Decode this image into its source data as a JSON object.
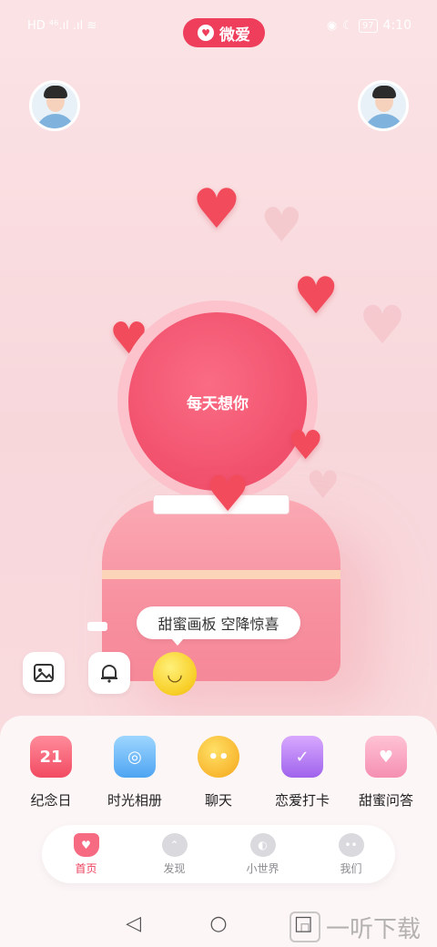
{
  "status_bar": {
    "left_glyphs": "HD ⁴⁶.ıl .ıl ≋",
    "battery": "97",
    "time": "4:10"
  },
  "app": {
    "title": "微爱",
    "brand_color": "#ee3e5c"
  },
  "avatars": {
    "left": "avatar-male",
    "right": "avatar-male"
  },
  "main": {
    "circle_text": "每天想你",
    "tooltip": "甜蜜画板 空降惊喜"
  },
  "tools": {
    "gallery_icon": "image-icon",
    "bell_icon": "bell-icon",
    "emoji_icon": "smiley-icon"
  },
  "features": [
    {
      "label": "纪念日",
      "icon": "calendar-icon",
      "badge": "21"
    },
    {
      "label": "时光相册",
      "icon": "camera-icon",
      "badge": ""
    },
    {
      "label": "聊天",
      "icon": "chat-icon",
      "badge": ""
    },
    {
      "label": "恋爱打卡",
      "icon": "checkin-icon",
      "badge": ""
    },
    {
      "label": "甜蜜问答",
      "icon": "qa-icon",
      "badge": ""
    }
  ],
  "tabs": [
    {
      "label": "首页",
      "active": true
    },
    {
      "label": "发现",
      "active": false
    },
    {
      "label": "小世界",
      "active": false
    },
    {
      "label": "我们",
      "active": false
    }
  ],
  "watermark": {
    "text": "一听下载"
  }
}
